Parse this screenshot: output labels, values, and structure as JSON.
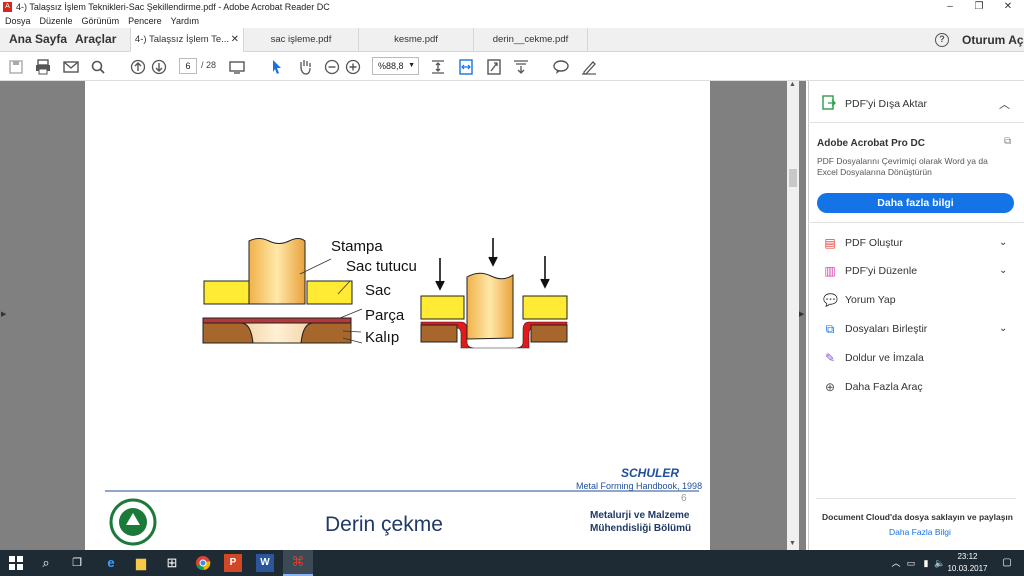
{
  "window": {
    "title": "4-) Talaşsız İşlem Teknikleri-Sac Şekillendirme.pdf - Adobe Acrobat Reader DC",
    "controls": [
      "–",
      "❐",
      "✕"
    ]
  },
  "menu": [
    "Dosya",
    "Düzenle",
    "Görünüm",
    "Pencere",
    "Yardım"
  ],
  "tabs": {
    "home": "Ana Sayfa",
    "tools": "Araçlar",
    "docs": [
      "4-) Talaşsız İşlem Te...",
      "sac işleme.pdf",
      "kesme.pdf",
      "derin__cekme.pdf"
    ],
    "close": "✕",
    "help": "?",
    "signin": "Oturum Aç"
  },
  "toolbar": {
    "page_current": "6",
    "page_total": "/ 28",
    "zoom": "%88,8"
  },
  "document": {
    "labels": [
      "Stampa",
      "Sac tutucu",
      "Sac",
      "Parça",
      "Kalıp"
    ],
    "logo_text": "SCHULER",
    "source": "Metal Forming Handbook, 1998",
    "page_number": "6",
    "heading": "Derin çekme",
    "dept_line1": "Metalurji ve Malzeme",
    "dept_line2": "Mühendisliği Bölümü"
  },
  "panel": {
    "export": "PDF'yi Dışa Aktar",
    "product": "Adobe Acrobat Pro DC",
    "desc1": "PDF Dosyalarını Çevrimiçi olarak Word ya da",
    "desc2": "Excel Dosyalarına Dönüştürün",
    "more_button": "Daha fazla bilgi",
    "tools": [
      "PDF Oluştur",
      "PDF'yi Düzenle",
      "Yorum Yap",
      "Dosyaları Birleştir",
      "Doldur ve İmzala",
      "Daha Fazla Araç"
    ],
    "cloud": "Document Cloud'da dosya saklayın ve paylaşın",
    "more_info": "Daha Fazla Bilgi"
  },
  "taskbar": {
    "time": "23:12",
    "date": "10.03.2017"
  }
}
